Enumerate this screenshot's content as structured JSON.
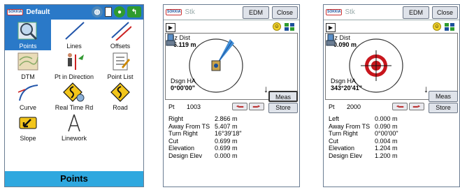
{
  "menu": {
    "logo": "SOKKIA",
    "title": "Default",
    "items": [
      {
        "label": "Points"
      },
      {
        "label": "Lines"
      },
      {
        "label": "Offsets"
      },
      {
        "label": "DTM"
      },
      {
        "label": "Pt in Direction"
      },
      {
        "label": "Point List"
      },
      {
        "label": "Curve"
      },
      {
        "label": "Real Time Rd"
      },
      {
        "label": "Road"
      },
      {
        "label": "Slope"
      },
      {
        "label": "Linework"
      }
    ],
    "bottom_label": "Points",
    "selected": "Points"
  },
  "stake_left": {
    "logo": "SOKKIA",
    "title": "Stk",
    "edm_label": "EDM",
    "close_label": "Close",
    "hz_label": "Hz Dist",
    "hz_value": "6.119",
    "hz_unit": "m",
    "ha_label": "Dsgn HA",
    "ha_value": "0°00'00\"",
    "meas_label": "Meas",
    "store_label": "Store",
    "pt_label": "Pt",
    "pt_value": "1003",
    "rows": [
      {
        "k": "Right",
        "v": "2.866 m"
      },
      {
        "k": "Away From TS",
        "v": "5.407 m"
      },
      {
        "k": "Turn Right",
        "v": "16°39'18\""
      },
      {
        "k": "Cut",
        "v": "0.699 m"
      },
      {
        "k": "Elevation",
        "v": "0.699 m"
      },
      {
        "k": "Design Elev",
        "v": "0.000 m"
      }
    ]
  },
  "stake_right": {
    "logo": "SOKKIA",
    "title": "Stk",
    "edm_label": "EDM",
    "close_label": "Close",
    "hz_label": "Hz Dist",
    "hz_value": "0.090",
    "hz_unit": "m",
    "ha_label": "Dsgn HA",
    "ha_value": "343°20'41\"",
    "meas_label": "Meas",
    "store_label": "Store",
    "pt_label": "Pt",
    "pt_value": "2000",
    "rows": [
      {
        "k": "Left",
        "v": "0.000 m"
      },
      {
        "k": "Away From TS",
        "v": "0.090 m"
      },
      {
        "k": "Turn Right",
        "v": "0°00'00\""
      },
      {
        "k": "Cut",
        "v": "0.004 m"
      },
      {
        "k": "Elevation",
        "v": "1.204 m"
      },
      {
        "k": "Design Elev",
        "v": "1.200 m"
      }
    ]
  },
  "colors": {
    "titlebar_blue": "#2a79c8",
    "bottombar_cyan": "#2fa8df",
    "target_red": "#c8161d"
  }
}
